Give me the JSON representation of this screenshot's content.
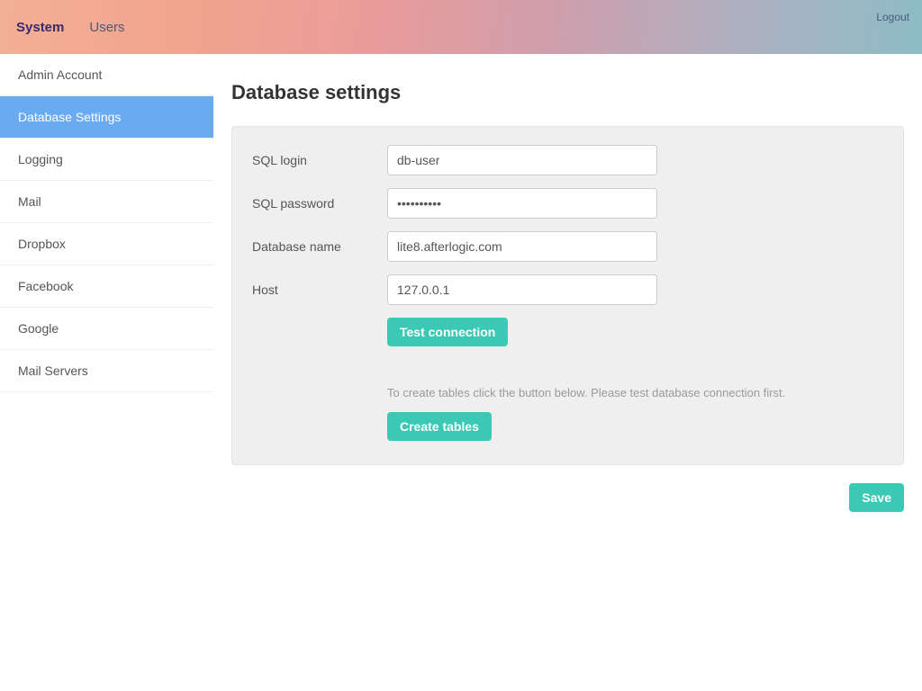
{
  "header": {
    "tabs": [
      {
        "label": "System",
        "active": true
      },
      {
        "label": "Users",
        "active": false
      }
    ],
    "logout": "Logout"
  },
  "sidebar": {
    "items": [
      {
        "label": "Admin Account",
        "active": false
      },
      {
        "label": "Database Settings",
        "active": true
      },
      {
        "label": "Logging",
        "active": false
      },
      {
        "label": "Mail",
        "active": false
      },
      {
        "label": "Dropbox",
        "active": false
      },
      {
        "label": "Facebook",
        "active": false
      },
      {
        "label": "Google",
        "active": false
      },
      {
        "label": "Mail Servers",
        "active": false
      }
    ]
  },
  "page": {
    "title": "Database settings"
  },
  "form": {
    "sql_login": {
      "label": "SQL login",
      "value": "db-user"
    },
    "sql_password": {
      "label": "SQL password",
      "value": "••••••••••"
    },
    "database_name": {
      "label": "Database name",
      "value": "lite8.afterlogic.com"
    },
    "host": {
      "label": "Host",
      "value": "127.0.0.1"
    },
    "test_connection": "Test connection",
    "hint": "To create tables click the button below. Please test database connection first.",
    "create_tables": "Create tables"
  },
  "actions": {
    "save": "Save"
  }
}
